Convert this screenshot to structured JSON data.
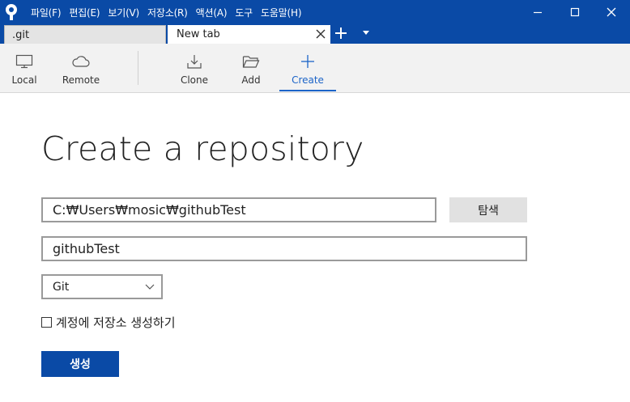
{
  "app": {
    "name": "Sourcetree",
    "accent_color": "#0a4aa6",
    "highlight_color": "#1c64c8"
  },
  "menu": [
    "파일(F)",
    "편집(E)",
    "보기(V)",
    "저장소(R)",
    "액션(A)",
    "도구",
    "도움말(H)"
  ],
  "window_controls": {
    "icons": [
      "minimize-icon",
      "maximize-icon",
      "close-icon"
    ]
  },
  "tabs": [
    {
      "label": ".git",
      "active": false
    },
    {
      "label": "New tab",
      "active": true
    }
  ],
  "toolbar": {
    "items": [
      {
        "label": "Local",
        "icon": "monitor-icon"
      },
      {
        "label": "Remote",
        "icon": "cloud-icon"
      },
      {
        "label": "Clone",
        "icon": "download-icon"
      },
      {
        "label": "Add",
        "icon": "folder-open-icon"
      },
      {
        "label": "Create",
        "icon": "plus-icon",
        "selected": true
      }
    ]
  },
  "form": {
    "heading": "Create a repository",
    "path_value": "C:₩Users₩mosic₩githubTest",
    "browse_label": "탐색",
    "name_value": "githubTest",
    "repo_type": "Git",
    "account_checkbox_label": "계정에 저장소 생성하기",
    "account_checkbox_checked": false,
    "create_label": "생성"
  }
}
